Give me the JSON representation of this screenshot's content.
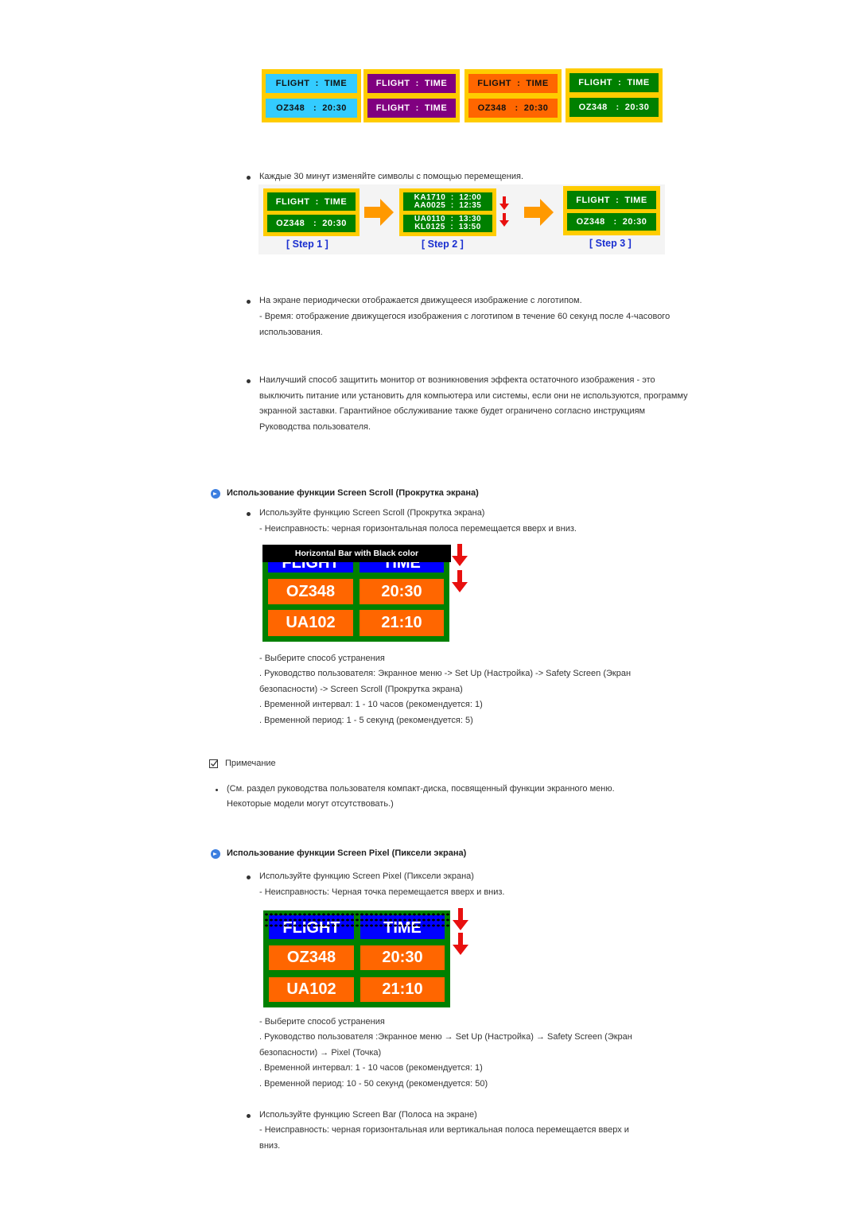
{
  "top_panels": [
    {
      "row1": "FLIGHT  :  TIME",
      "row2": "OZ348   :  20:30",
      "bg": "#33ccff",
      "fg": "#111111"
    },
    {
      "row1": "FLIGHT  :  TIME",
      "row2": "FLIGHT  :  TIME",
      "bg": "#800080",
      "fg": "#ffffff"
    },
    {
      "row1": "FLIGHT  :  TIME",
      "row2": "OZ348   :  20:30",
      "bg": "#ff6600",
      "fg": "#111111"
    },
    {
      "row1": "FLIGHT  :  TIME",
      "row2": "OZ348   :  20:30",
      "bg": "#008000",
      "fg": "#ffffff"
    }
  ],
  "section1": {
    "bullet": "Каждые 30 минут изменяйте символы с помощью перемещения.",
    "steps": [
      {
        "label": "[  Step 1  ]",
        "row1": "FLIGHT  :  TIME",
        "row2": "OZ348   :  20:30"
      },
      {
        "label": "[  Step 2  ]",
        "row1a": "KA1710  :  12:00",
        "row1b": "AA0025  :  12:35",
        "row2a": "UA0110  :  13:30",
        "row2b": "KL0125  :  13:50"
      },
      {
        "label": "[  Step 3  ]",
        "row1": "FLIGHT  :  TIME",
        "row2": "OZ348   :  20:30"
      }
    ]
  },
  "section2": {
    "bullet": "На экране периодически отображается движущееся изображение с логотипом.",
    "detail": "- Время: отображение движущегося изображения с логотипом в течение 60 секунд после 4-часового использования."
  },
  "section3": {
    "bullet": "Наилучший способ защитить монитор от возникновения эффекта остаточного изображения - это выключить питание или установить для компьютера или системы, если они не используются, программу экранной заставки. Гарантийное обслуживание также будет ограничено согласно инструкциям Руководства пользователя."
  },
  "scroll": {
    "heading": "Использование функции Screen Scroll (Прокрутка экрана)",
    "bullet": "Используйте функцию Screen Scroll (Прокрутка экрана)",
    "issue": "- Неисправность: черная горизонтальная полоса перемещается вверх и вниз.",
    "banner": "Horizontal Bar with Black color",
    "board": {
      "h1": "FLIGHT",
      "h2": "TIME",
      "r1c1": "OZ348",
      "r1c2": "20:30",
      "r2c1": "UA102",
      "r2c2": "21:10"
    },
    "fix_title": "- Выберите способ устранения",
    "fix_path_1": ". Руководство пользователя: Экранное меню -> Set Up (Настройка) -> Safety Screen (Экран",
    "fix_path_2": "безопасности) -> Screen Scroll (Прокрутка экрана)",
    "interval": ". Временной интервал: 1 - 10 часов (рекомендуется: 1)",
    "period": ". Временной период: 1 - 5 секунд (рекомендуется: 5)"
  },
  "note": {
    "title": "Примечание",
    "text_1": "(См. раздел руководства пользователя компакт-диска, посвященный функции экранного меню.",
    "text_2": "Некоторые модели могут отсутствовать.)"
  },
  "pixel": {
    "heading": "Использование функции Screen Pixel (Пиксели экрана)",
    "bullet": "Используйте функцию Screen Pixel (Пиксели экрана)",
    "issue": "- Неисправность: Черная точка перемещается вверх и вниз.",
    "board": {
      "h1": "FLIGHT",
      "h2": "TIME",
      "r1c1": "OZ348",
      "r1c2": "20:30",
      "r2c1": "UA102",
      "r2c2": "21:10"
    },
    "fix_title": "- Выберите способ устранения",
    "fix_path_1": ". Руководство пользователя :Экранное меню → Set Up (Настройка) → Safety Screen (Экран",
    "fix_path_2": "безопасности) → Pixel (Точка)",
    "interval": ". Временной интервал: 1 - 10 часов (рекомендуется: 1)",
    "period": ". Временной период: 10 - 50 секунд (рекомендуется: 50)"
  },
  "bar": {
    "bullet": "Используйте функцию Screen Bar (Полоса на экране)",
    "issue_1": "- Неисправность: черная горизонтальная или вертикальная полоса перемещается вверх и",
    "issue_2": "вниз."
  },
  "colors": {
    "panel_border": "#ffcc00",
    "green": "#008000",
    "orange": "#ff6600",
    "blue": "#0000ff",
    "step_blue": "#1a2fd0",
    "arrow_orange": "#ff9900",
    "arrow_red": "#e8100f",
    "icon_blue": "#3d7fe0"
  }
}
